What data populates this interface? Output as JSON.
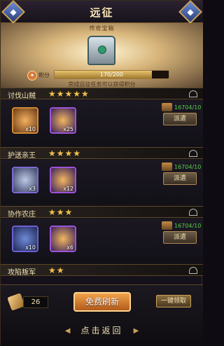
{
  "header": {
    "title": "远征"
  },
  "banner": {
    "chest_title": "传奇宝箱",
    "points_label": "积分",
    "progress_text": "170/200",
    "progress_fraction": 0.85,
    "hint": "完成远征任务可以获得积分"
  },
  "missions": [
    {
      "name": "讨伐山贼",
      "stars": "★★★★★",
      "items": [
        {
          "count": "x10",
          "icon": "orange-emblem-icon"
        },
        {
          "count": "x25",
          "icon": "gold-scroll-icon"
        }
      ],
      "troops": "16704/10",
      "dispatch_label": "派遣"
    },
    {
      "name": "护送亲王",
      "stars": "★★★★",
      "items": [
        {
          "count": "x3",
          "icon": "silver-emblem-icon"
        },
        {
          "count": "x12",
          "icon": "gold-scroll-icon"
        }
      ],
      "troops": "16704/10",
      "dispatch_label": "派遣"
    },
    {
      "name": "协作农庄",
      "stars": "★★★",
      "items": [
        {
          "count": "x10",
          "icon": "blue-emblem-icon"
        },
        {
          "count": "x6",
          "icon": "gold-scroll-icon"
        }
      ],
      "troops": "16704/10",
      "dispatch_label": "派遣"
    },
    {
      "name": "攻陷叛军",
      "stars": "★★"
    }
  ],
  "footer": {
    "feather_count": "26",
    "refresh_label": "免费刷新",
    "claim_label": "一键领取",
    "back_label": "点击返回",
    "back_left_arrow": "◀",
    "back_right_arrow": "▶"
  }
}
